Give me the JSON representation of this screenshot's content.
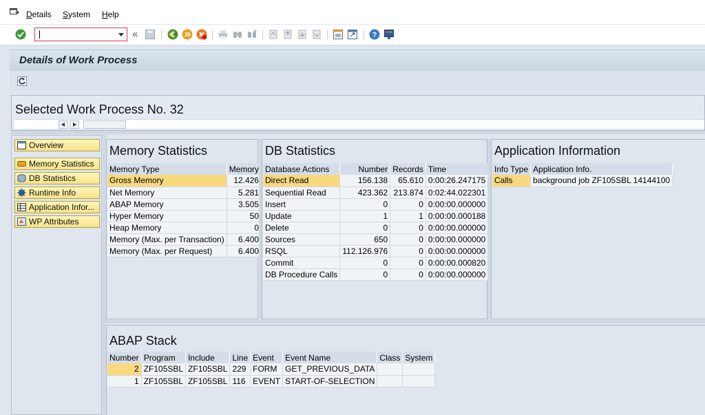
{
  "menu": {
    "items": [
      {
        "prefix": "",
        "mnemonic": "D",
        "rest": "etails"
      },
      {
        "prefix": "",
        "mnemonic": "S",
        "rest": "ystem"
      },
      {
        "prefix": "",
        "mnemonic": "H",
        "rest": "elp"
      }
    ]
  },
  "toolbar": {
    "command_value": "",
    "back_glyph": "«"
  },
  "title": "Details of Work Process",
  "selected_wp": {
    "title": "Selected Work Process No. 32"
  },
  "nav": {
    "items": [
      "Overview",
      "Memory Statistics",
      "DB Statistics",
      "Runtime Info",
      "Application Infor...",
      "WP Attributes"
    ]
  },
  "memory": {
    "title": "Memory Statistics",
    "columns": [
      "Memory Type",
      "Memory"
    ],
    "rows": [
      [
        "Gross Memory",
        "12.426"
      ],
      [
        "Net Memory",
        "5.281"
      ],
      [
        "ABAP Memory",
        "3.505"
      ],
      [
        "Hyper Memory",
        "50"
      ],
      [
        "Heap Memory",
        "0"
      ],
      [
        "Memory (Max. per Transaction)",
        "6.400"
      ],
      [
        "Memory (Max. per Request)",
        "6.400"
      ]
    ]
  },
  "db": {
    "title": "DB Statistics",
    "columns": [
      "Database Actions",
      "Number",
      "Records",
      "Time"
    ],
    "rows": [
      [
        "Direct Read",
        "156.138",
        "65.610",
        "0:00:26.247175"
      ],
      [
        "Sequential Read",
        "423.362",
        "213.874",
        "0:02:44.022301"
      ],
      [
        "Insert",
        "0",
        "0",
        "0:00:00.000000"
      ],
      [
        "Update",
        "1",
        "1",
        "0:00:00.000188"
      ],
      [
        "Delete",
        "0",
        "0",
        "0:00:00.000000"
      ],
      [
        "Sources",
        "650",
        "0",
        "0:00:00.000000"
      ],
      [
        "RSQL",
        "112.126.976",
        "0",
        "0:00:00.000000"
      ],
      [
        "Commit",
        "0",
        "0",
        "0:00:00.000820"
      ],
      [
        "DB Procedure Calls",
        "0",
        "0",
        "0:00:00.000000"
      ]
    ]
  },
  "app": {
    "title": "Application Information",
    "columns": [
      "Info Type",
      "Application Info."
    ],
    "rows": [
      [
        "Calls",
        "background job ZF105SBL 14144100"
      ]
    ]
  },
  "stack": {
    "title": "ABAP Stack",
    "columns": [
      "Number",
      "Program",
      "Include",
      "Line",
      "Event",
      "Event Name",
      "Class",
      "System"
    ],
    "rows": [
      [
        "2",
        "ZF105SBL",
        "ZF105SBL",
        "229",
        "FORM",
        "GET_PREVIOUS_DATA",
        "",
        ""
      ],
      [
        "1",
        "ZF105SBL",
        "ZF105SBL",
        "116",
        "EVENT",
        "START-OF-SELECTION",
        "",
        ""
      ]
    ]
  },
  "colors": {
    "highlight": "#f9d980",
    "nav_button": "#f6e38a",
    "header": "#d5dee8"
  }
}
